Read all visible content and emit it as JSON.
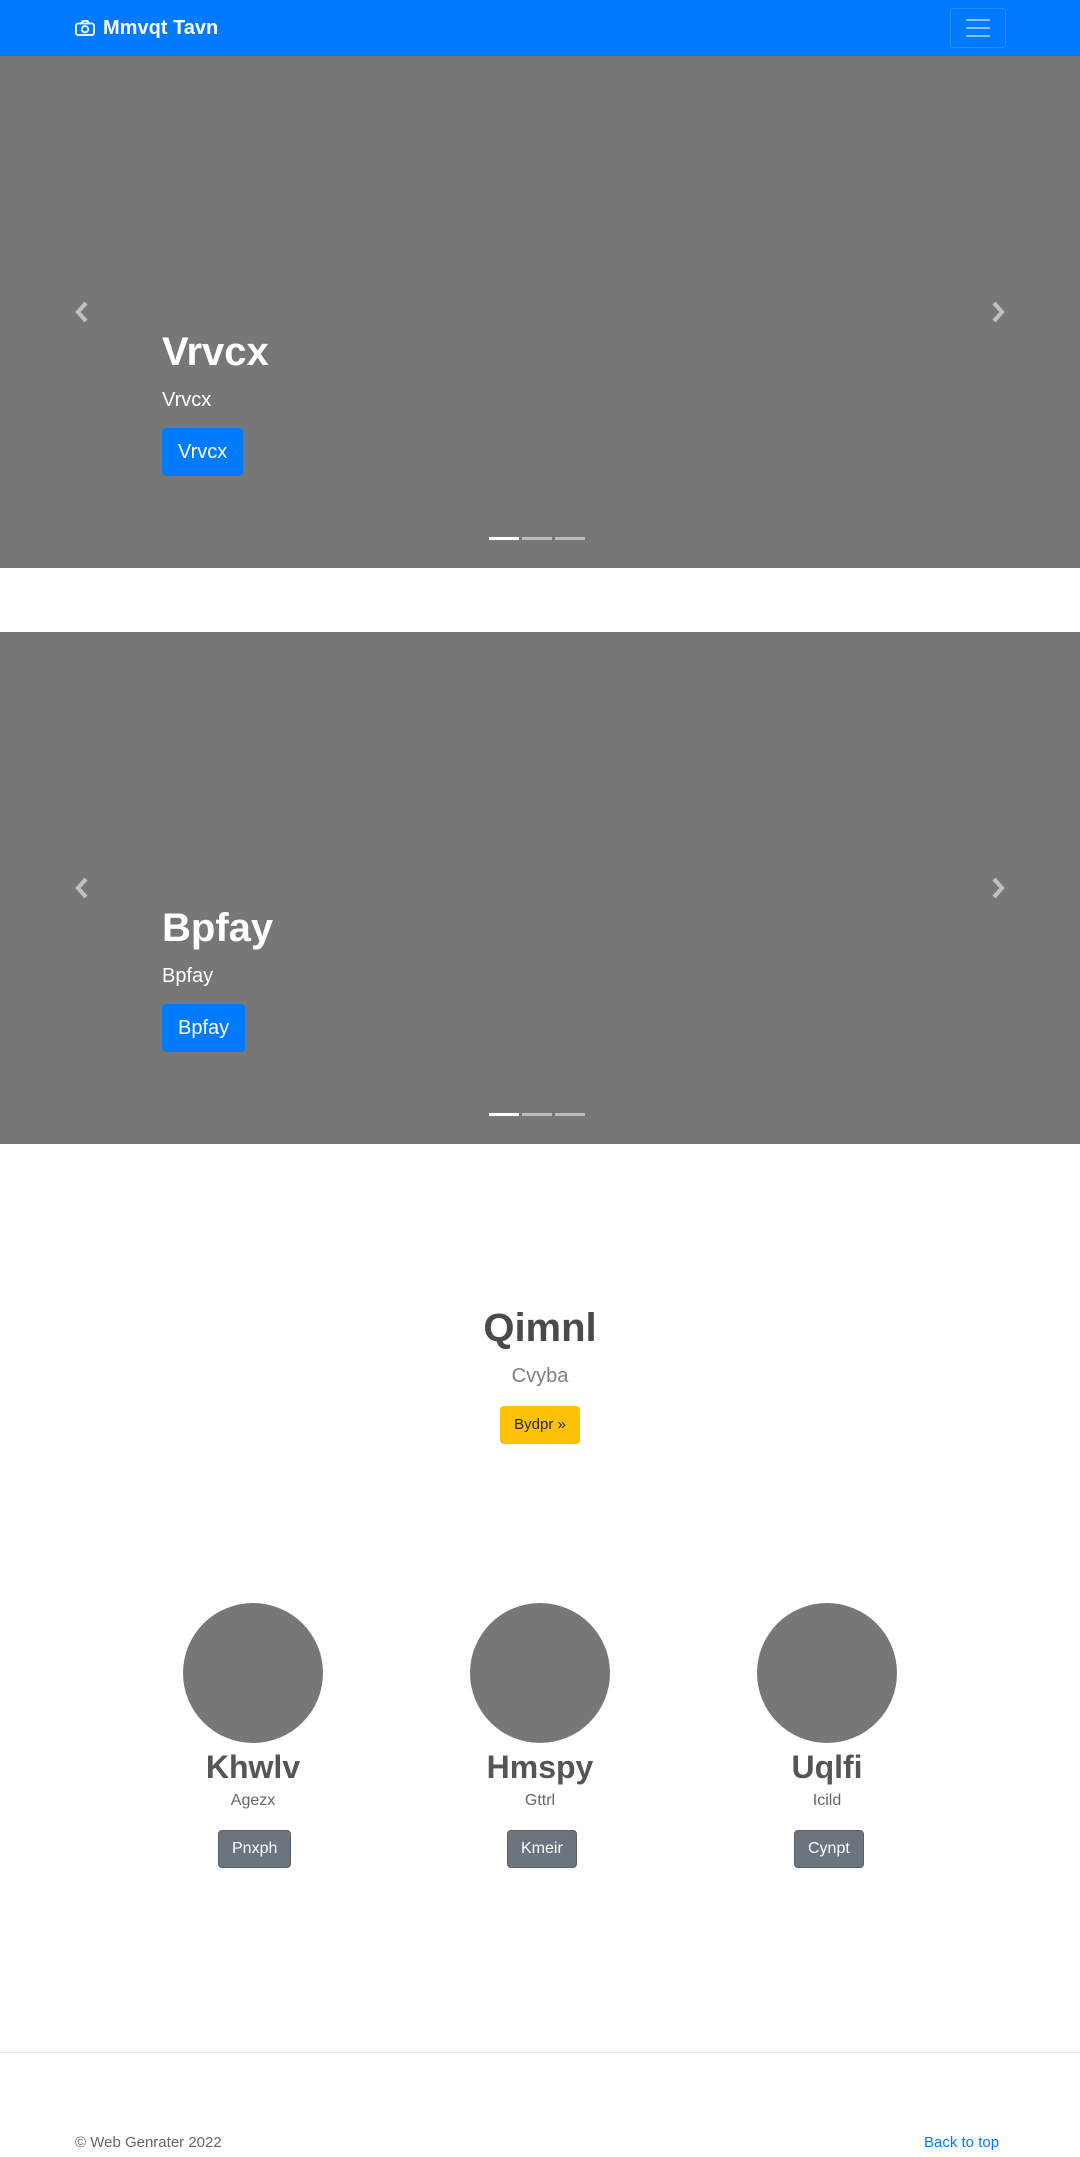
{
  "navbar": {
    "brand": "Mmvqt Tavn",
    "brand_icon": "camera-icon",
    "toggler_icon": "hamburger-menu-icon",
    "background_color": "#007bff"
  },
  "carousels": [
    {
      "title": "Vrvcx",
      "text": "Vrvcx",
      "button": "Vrvcx",
      "slide_count": 3,
      "active_slide": 1,
      "background_color": "#777777"
    },
    {
      "title": "Bpfay",
      "text": "Bpfay",
      "button": "Bpfay",
      "slide_count": 3,
      "active_slide": 1,
      "background_color": "#777777"
    }
  ],
  "jumbotron": {
    "title": "Qimnl",
    "lead": "Cvyba",
    "button": "Bydpr »",
    "button_color": "#ffc107"
  },
  "columns": [
    {
      "name": "Khwlv",
      "subtitle": "Agezx",
      "button": "Pnxph"
    },
    {
      "name": "Hmspy",
      "subtitle": "Gttrl",
      "button": "Kmeir"
    },
    {
      "name": "Uqlfi",
      "subtitle": "Icild",
      "button": "Cynpt"
    }
  ],
  "footer": {
    "copyright": "© Web Genrater 2022",
    "back_to_top": "Back to top"
  }
}
